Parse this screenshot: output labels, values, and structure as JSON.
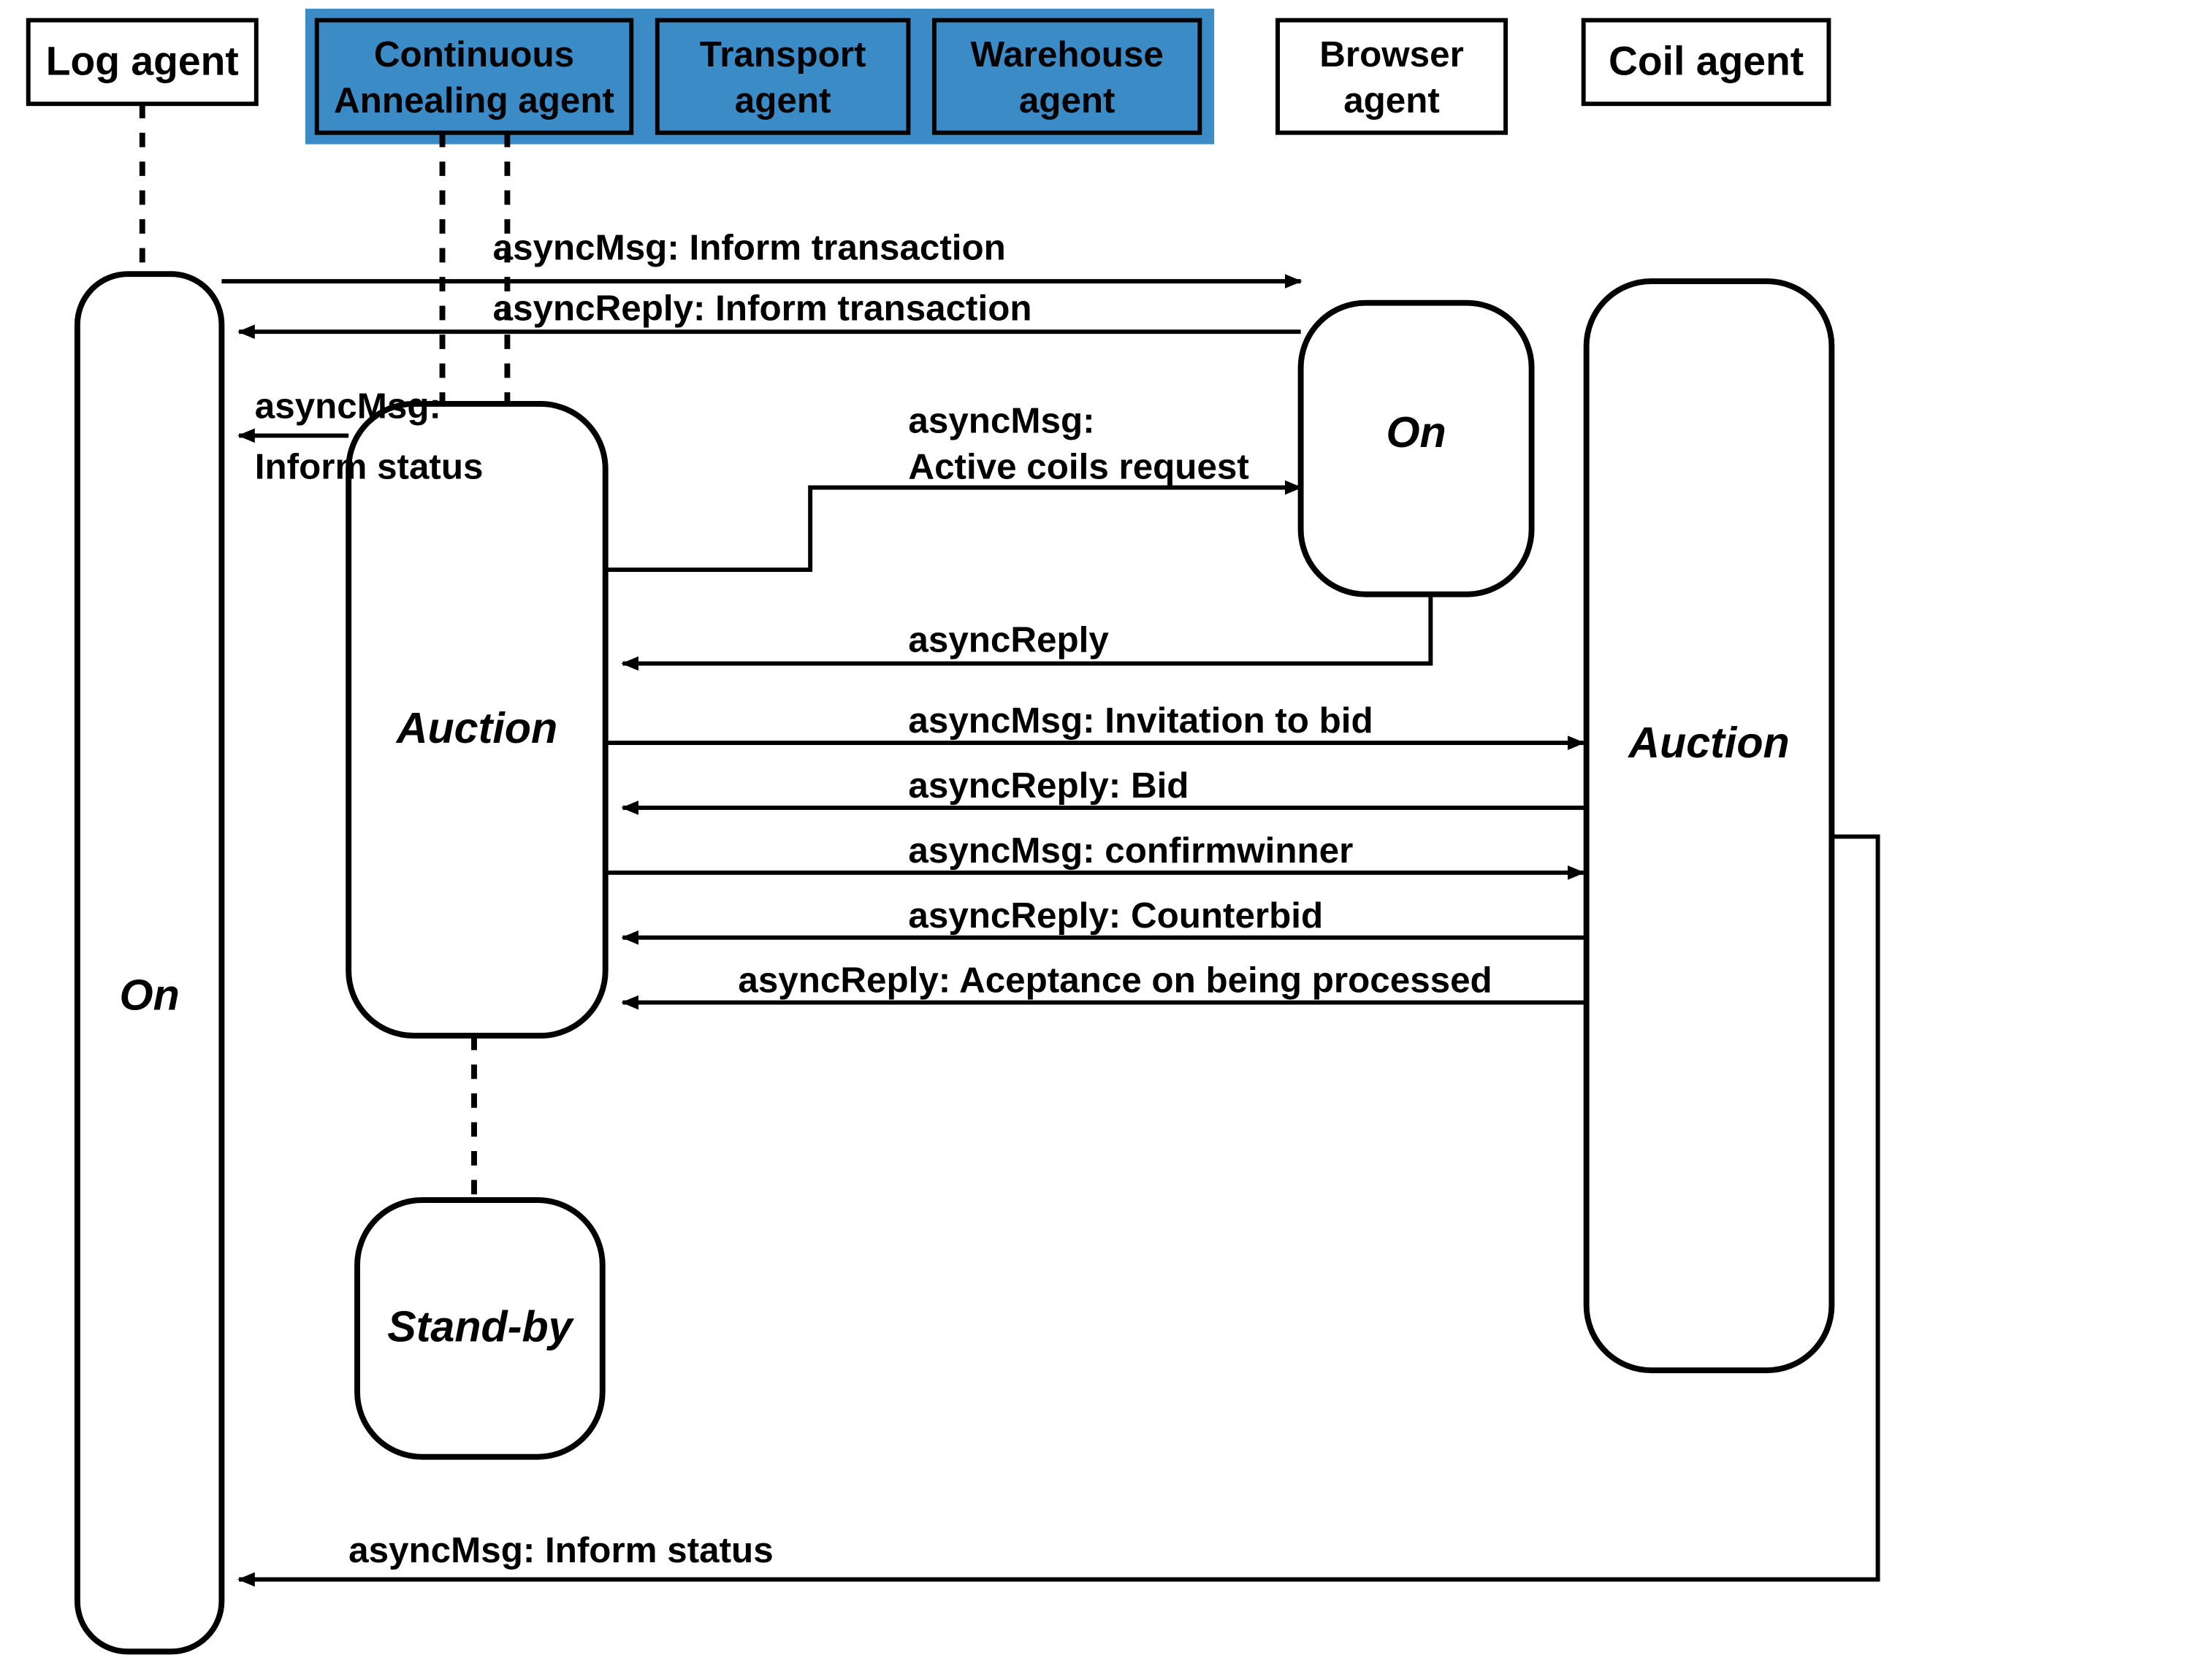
{
  "agents": {
    "log": "Log agent",
    "ca_line1": "Continuous",
    "ca_line2": "Annealing agent",
    "transport_line1": "Transport",
    "transport_line2": "agent",
    "warehouse_line1": "Warehouse",
    "warehouse_line2": "agent",
    "browser_line1": "Browser",
    "browser_line2": "agent",
    "coil": "Coil agent"
  },
  "states": {
    "log_on": "On",
    "ca_auction": "Auction",
    "ca_standby": "Stand-by",
    "browser_on": "On",
    "coil_auction": "Auction"
  },
  "messages": {
    "m1": "asyncMsg: Inform transaction",
    "m2": "asyncReply: Inform transaction",
    "m3a": "asyncMsg:",
    "m3b": "Inform status",
    "m4a": "asyncMsg:",
    "m4b": "Active coils request",
    "m5": "asyncReply",
    "m6": "asyncMsg: Invitation to bid",
    "m7": "asyncReply: Bid",
    "m8": "asyncMsg: confirmwinner",
    "m9": "asyncReply: Counterbid",
    "m10": "asyncReply: Aceptance on being processed",
    "m11": "asyncMsg: Inform status"
  }
}
